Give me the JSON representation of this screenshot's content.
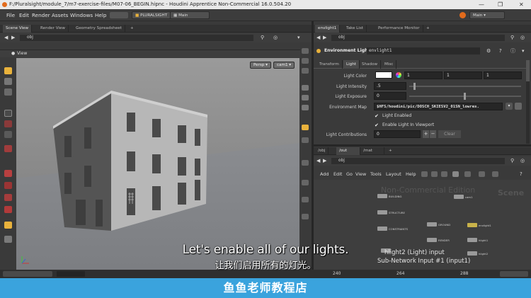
{
  "window": {
    "title": "F:/Pluralsight/module_7/m7-exercise-files/M07-06_BEGIN.hipnc - Houdini Apprentice Non-Commercial 16.0.504.20",
    "min_glyph": "—",
    "max_glyph": "❐",
    "close_glyph": "✕"
  },
  "menubar": {
    "items": [
      "File",
      "Edit",
      "Render",
      "Assets",
      "Windows",
      "Help"
    ],
    "shelf_label": "PLURALSIGHT",
    "desktop_left": "Main",
    "desktop_right": "Main"
  },
  "left_tabs": [
    "Scene View",
    "Render View",
    "Geometry Spreadsheet",
    "+"
  ],
  "left_path": {
    "network": "obj"
  },
  "viewport": {
    "label": "View",
    "persp": "Persp",
    "cam": "cam1",
    "watermark": "Non-Commercial Edition"
  },
  "right_top_tabs": [
    "envlight1",
    "Take List",
    "Performance Monitor",
    "+"
  ],
  "param_path": {
    "network": "obj"
  },
  "param_header": {
    "type_label": "Environment Light",
    "node_name": "envlight1"
  },
  "param_tabs": [
    "Transform",
    "Light",
    "Shadow",
    "Misc"
  ],
  "params": {
    "light_color_label": "Light Color",
    "light_color_values": [
      "1",
      "1",
      "1"
    ],
    "intensity_label": "Light Intensity",
    "intensity_value": ".5",
    "exposure_label": "Light Exposure",
    "exposure_value": "0",
    "env_map_label": "Environment Map",
    "env_map_value": "$HFS/houdini/pic/DOSCH_SKIESV2_01SN_lowres.",
    "light_enabled_label": "Light Enabled",
    "enable_viewport_label": "Enable Light In Viewport",
    "contributions_label": "Light Contributions",
    "contributions_value": "0",
    "clear_label": "Clear"
  },
  "network_tabs": [
    "/obj",
    "/out",
    "/mat",
    "+"
  ],
  "network_path": {
    "network": "obj"
  },
  "network_menu": [
    "Add",
    "Edit",
    "Go",
    "View",
    "Tools",
    "Layout",
    "Help"
  ],
  "network": {
    "watermark": "Non-Commercial Edition",
    "scene_label": "Scene",
    "info_line1": "hlight2 (Light) input",
    "info_line2": "Sub-Network Input #1 (input1)",
    "nodes": [
      "BUILDING",
      "STRUCTURE",
      "CONSTRAINTS",
      "GROUND",
      "cam1",
      "envlight1",
      "RENDER",
      "hlight1",
      "hlight2"
    ]
  },
  "timeline": {
    "frames": [
      "240",
      "264",
      "288"
    ]
  },
  "subtitles": {
    "english": "Let's enable all of our lights.",
    "chinese": "让我们启用所有的灯光。"
  },
  "banner": {
    "text": "鱼鱼老师教程店"
  },
  "colors": {
    "accent_yellow": "#e9b23c",
    "banner_blue": "#3aa3dd",
    "viewport_bg": "#8d8d8d"
  }
}
